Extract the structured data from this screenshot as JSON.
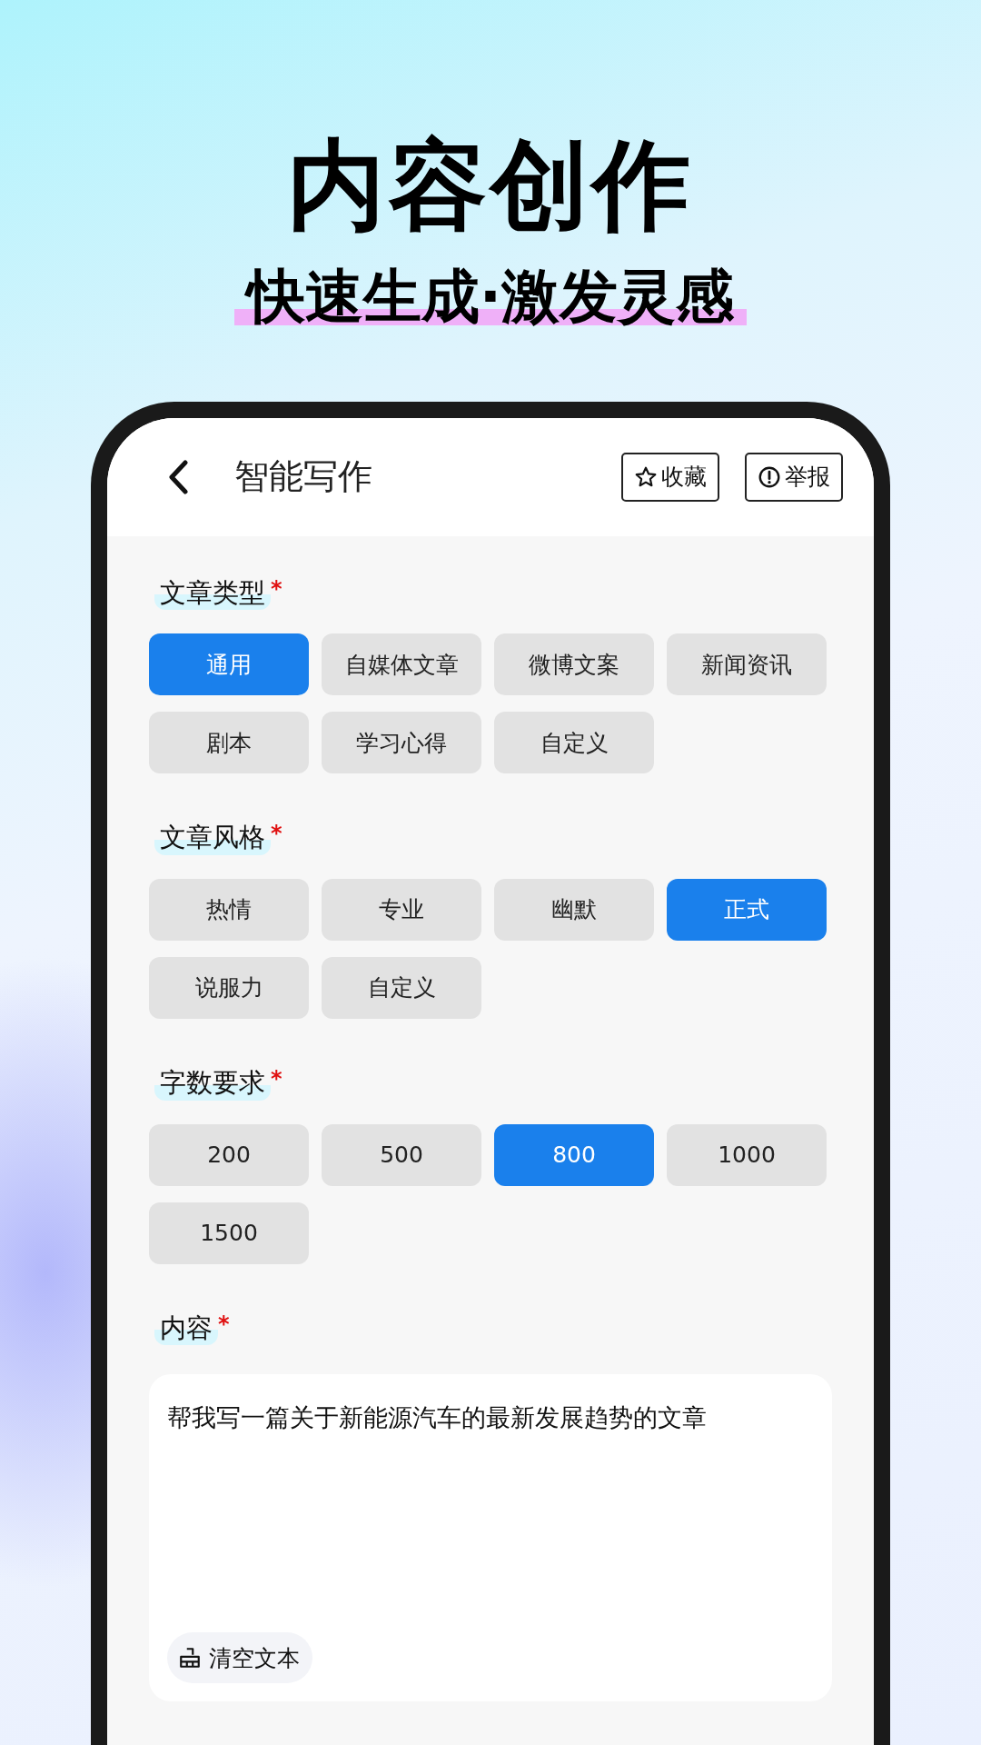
{
  "headline": "内容创作",
  "subheadline": "快速生成·激发灵感",
  "app_bar": {
    "title": "智能写作",
    "actions": [
      {
        "kind": "favorite",
        "label": "收藏"
      },
      {
        "kind": "report",
        "label": "举报"
      }
    ]
  },
  "sections": [
    {
      "label": "文章类型",
      "required_mark": "*",
      "options": [
        {
          "label": "通用",
          "selected": true
        },
        {
          "label": "自媒体文章",
          "selected": false
        },
        {
          "label": "微博文案",
          "selected": false
        },
        {
          "label": "新闻资讯",
          "selected": false
        },
        {
          "label": "剧本",
          "selected": false
        },
        {
          "label": "学习心得",
          "selected": false
        },
        {
          "label": "自定义",
          "selected": false
        }
      ]
    },
    {
      "label": "文章风格",
      "required_mark": "*",
      "options": [
        {
          "label": "热情",
          "selected": false
        },
        {
          "label": "专业",
          "selected": false
        },
        {
          "label": "幽默",
          "selected": false
        },
        {
          "label": "正式",
          "selected": true
        },
        {
          "label": "说服力",
          "selected": false
        },
        {
          "label": "自定义",
          "selected": false
        }
      ]
    },
    {
      "label": "字数要求",
      "required_mark": "*",
      "options": [
        {
          "label": "200",
          "selected": false
        },
        {
          "label": "500",
          "selected": false
        },
        {
          "label": "800",
          "selected": true
        },
        {
          "label": "1000",
          "selected": false
        },
        {
          "label": "1500",
          "selected": false
        }
      ]
    }
  ],
  "content": {
    "label": "内容",
    "required_mark": "*",
    "value": "帮我写一篇关于新能源汽车的最新发展趋势的文章",
    "clear_button": "清空文本"
  }
}
